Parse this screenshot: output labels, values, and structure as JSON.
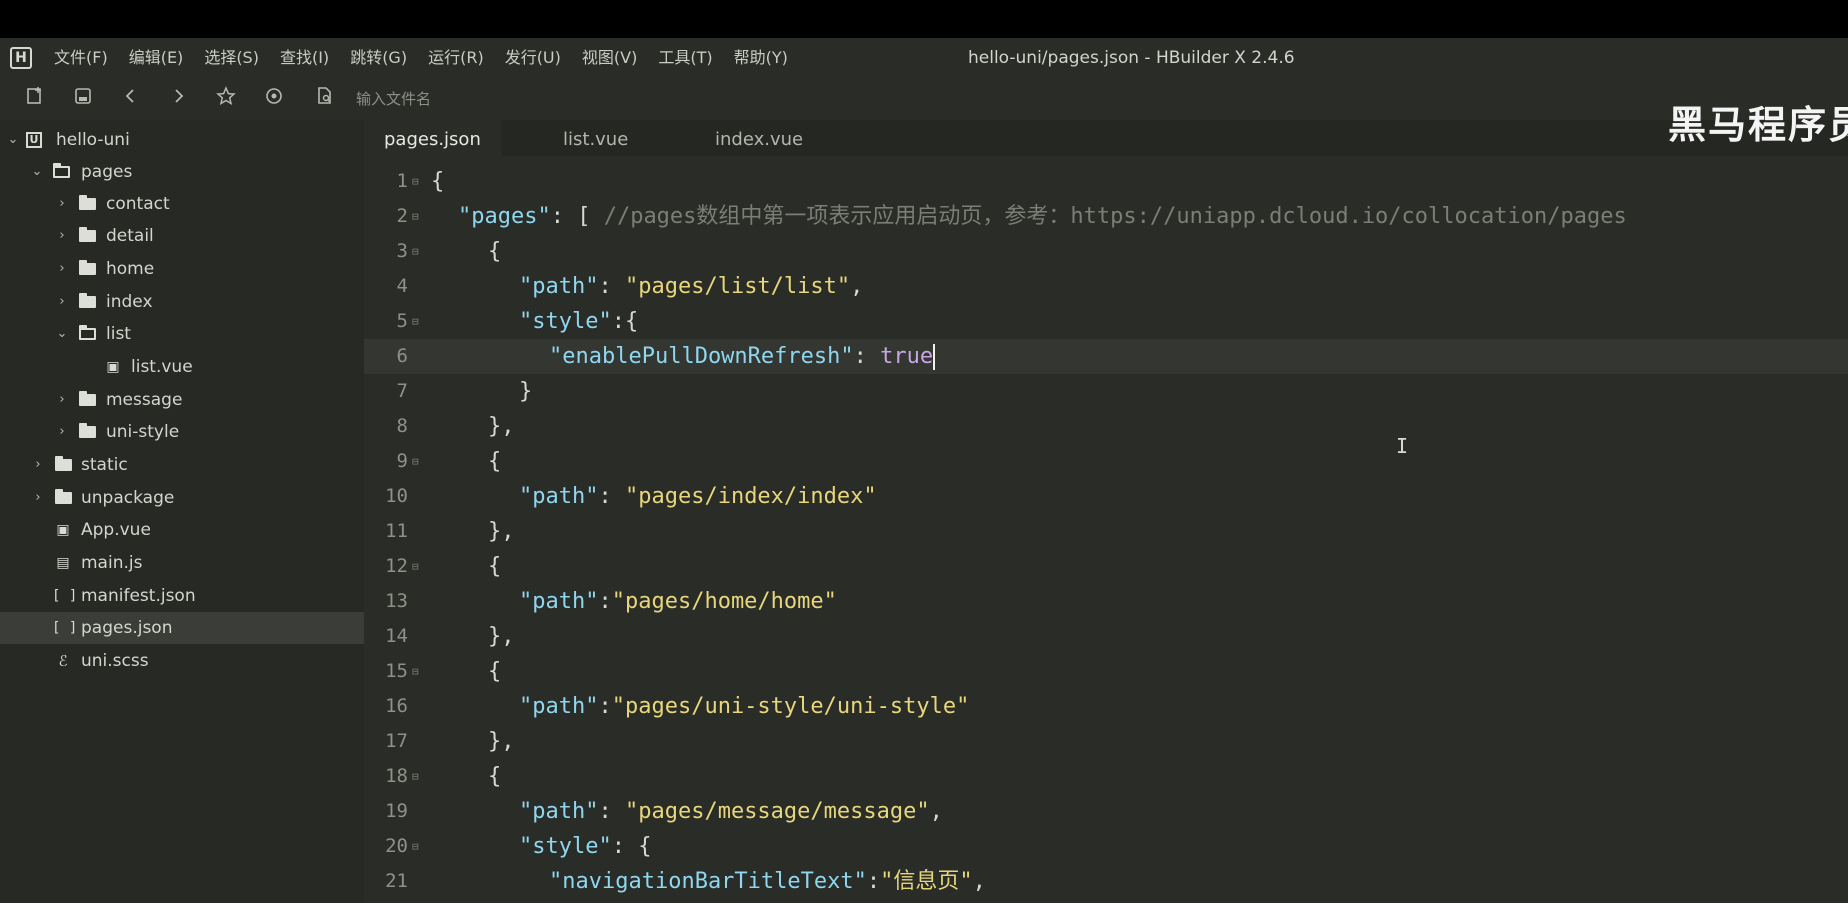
{
  "window": {
    "title": "hello-uni/pages.json - HBuilder X 2.4.6",
    "logo_letter": "H"
  },
  "menu": [
    {
      "label": "文件(F)"
    },
    {
      "label": "编辑(E)"
    },
    {
      "label": "选择(S)"
    },
    {
      "label": "查找(I)"
    },
    {
      "label": "跳转(G)"
    },
    {
      "label": "运行(R)"
    },
    {
      "label": "发行(U)"
    },
    {
      "label": "视图(V)"
    },
    {
      "label": "工具(T)"
    },
    {
      "label": "帮助(Y)"
    }
  ],
  "toolbar": {
    "icons": [
      "new-file-icon",
      "save-icon",
      "back-icon",
      "forward-icon",
      "star-icon",
      "target-icon",
      "file-search-icon"
    ],
    "search_placeholder": "输入文件名"
  },
  "sidebar": {
    "tree": [
      {
        "label": "hello-uni",
        "type": "project",
        "expanded": true
      },
      {
        "label": "pages",
        "type": "folder",
        "expanded": true
      },
      {
        "label": "contact",
        "type": "folder",
        "expanded": false
      },
      {
        "label": "detail",
        "type": "folder",
        "expanded": false
      },
      {
        "label": "home",
        "type": "folder",
        "expanded": false
      },
      {
        "label": "index",
        "type": "folder",
        "expanded": false
      },
      {
        "label": "list",
        "type": "folder",
        "expanded": true
      },
      {
        "label": "list.vue",
        "type": "vue-file"
      },
      {
        "label": "message",
        "type": "folder",
        "expanded": false
      },
      {
        "label": "uni-style",
        "type": "folder",
        "expanded": false
      },
      {
        "label": "static",
        "type": "folder",
        "expanded": false
      },
      {
        "label": "unpackage",
        "type": "folder",
        "expanded": false
      },
      {
        "label": "App.vue",
        "type": "vue-file"
      },
      {
        "label": "main.js",
        "type": "js-file"
      },
      {
        "label": "manifest.json",
        "type": "json-file"
      },
      {
        "label": "pages.json",
        "type": "json-file",
        "selected": true
      },
      {
        "label": "uni.scss",
        "type": "scss-file"
      }
    ]
  },
  "tabs": [
    {
      "label": "pages.json",
      "active": true
    },
    {
      "label": "list.vue",
      "active": false
    },
    {
      "label": "index.vue",
      "active": false
    }
  ],
  "watermark": "黑马程序员",
  "code_lines": [
    {
      "num": "1",
      "fold": true
    },
    {
      "num": "2",
      "fold": true
    },
    {
      "num": "3",
      "fold": true
    },
    {
      "num": "4",
      "fold": false
    },
    {
      "num": "5",
      "fold": true
    },
    {
      "num": "6",
      "fold": false
    },
    {
      "num": "7",
      "fold": false
    },
    {
      "num": "8",
      "fold": false
    },
    {
      "num": "9",
      "fold": true
    },
    {
      "num": "10",
      "fold": false
    },
    {
      "num": "11",
      "fold": false
    },
    {
      "num": "12",
      "fold": true
    },
    {
      "num": "13",
      "fold": false
    },
    {
      "num": "14",
      "fold": false
    },
    {
      "num": "15",
      "fold": true
    },
    {
      "num": "16",
      "fold": false
    },
    {
      "num": "17",
      "fold": false
    },
    {
      "num": "18",
      "fold": true
    },
    {
      "num": "19",
      "fold": false
    },
    {
      "num": "20",
      "fold": true
    },
    {
      "num": "21",
      "fold": false
    }
  ],
  "code": {
    "l1_open": "{",
    "l2_key": "\"pages\"",
    "l2_punc": ": [ ",
    "l2_comment": "//pages数组中第一项表示应用启动页，参考：https://uniapp.dcloud.io/collocation/pages",
    "l3": "{",
    "l4_key": "\"path\"",
    "l4_punc": ": ",
    "l4_val": "\"pages/list/list\"",
    "l4_end": ",",
    "l5_key": "\"style\"",
    "l5_punc": ":{",
    "l6_key": "\"enablePullDownRefresh\"",
    "l6_punc": ": ",
    "l6_val": "true",
    "l7": "}",
    "l8": "},",
    "l9": "{",
    "l10_key": "\"path\"",
    "l10_punc": ": ",
    "l10_val": "\"pages/index/index\"",
    "l11": "},",
    "l12": "{",
    "l13_key": "\"path\"",
    "l13_punc": ":",
    "l13_val": "\"pages/home/home\"",
    "l14": "},",
    "l15": "{",
    "l16_key": "\"path\"",
    "l16_punc": ":",
    "l16_val": "\"pages/uni-style/uni-style\"",
    "l17": "},",
    "l18": "{",
    "l19_key": "\"path\"",
    "l19_punc": ": ",
    "l19_val": "\"pages/message/message\"",
    "l19_end": ",",
    "l20_key": "\"style\"",
    "l20_punc": ": {",
    "l21_key": "\"navigationBarTitleText\"",
    "l21_punc": ":",
    "l21_val": "\"信息页\"",
    "l21_end": ","
  }
}
